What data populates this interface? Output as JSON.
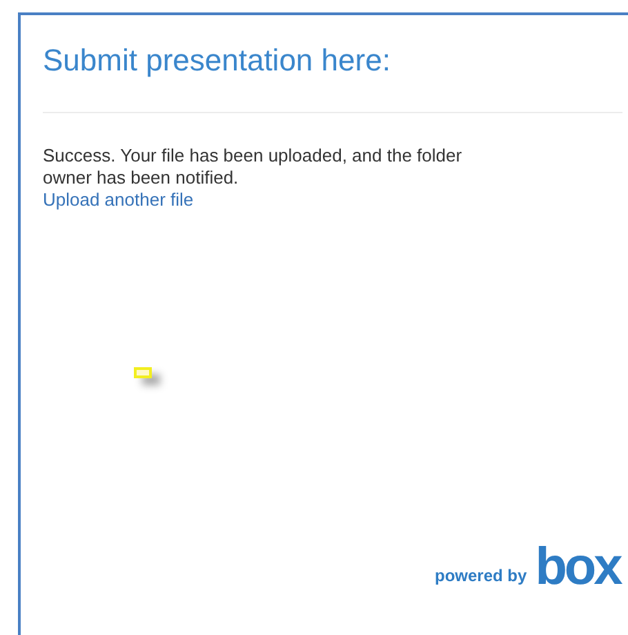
{
  "title": "Submit presentation here:",
  "message": "Success. Your file has been uploaded, and the folder owner has been notified.",
  "link": "Upload another file",
  "footer": {
    "powered_by": "powered by",
    "logo": "box"
  }
}
